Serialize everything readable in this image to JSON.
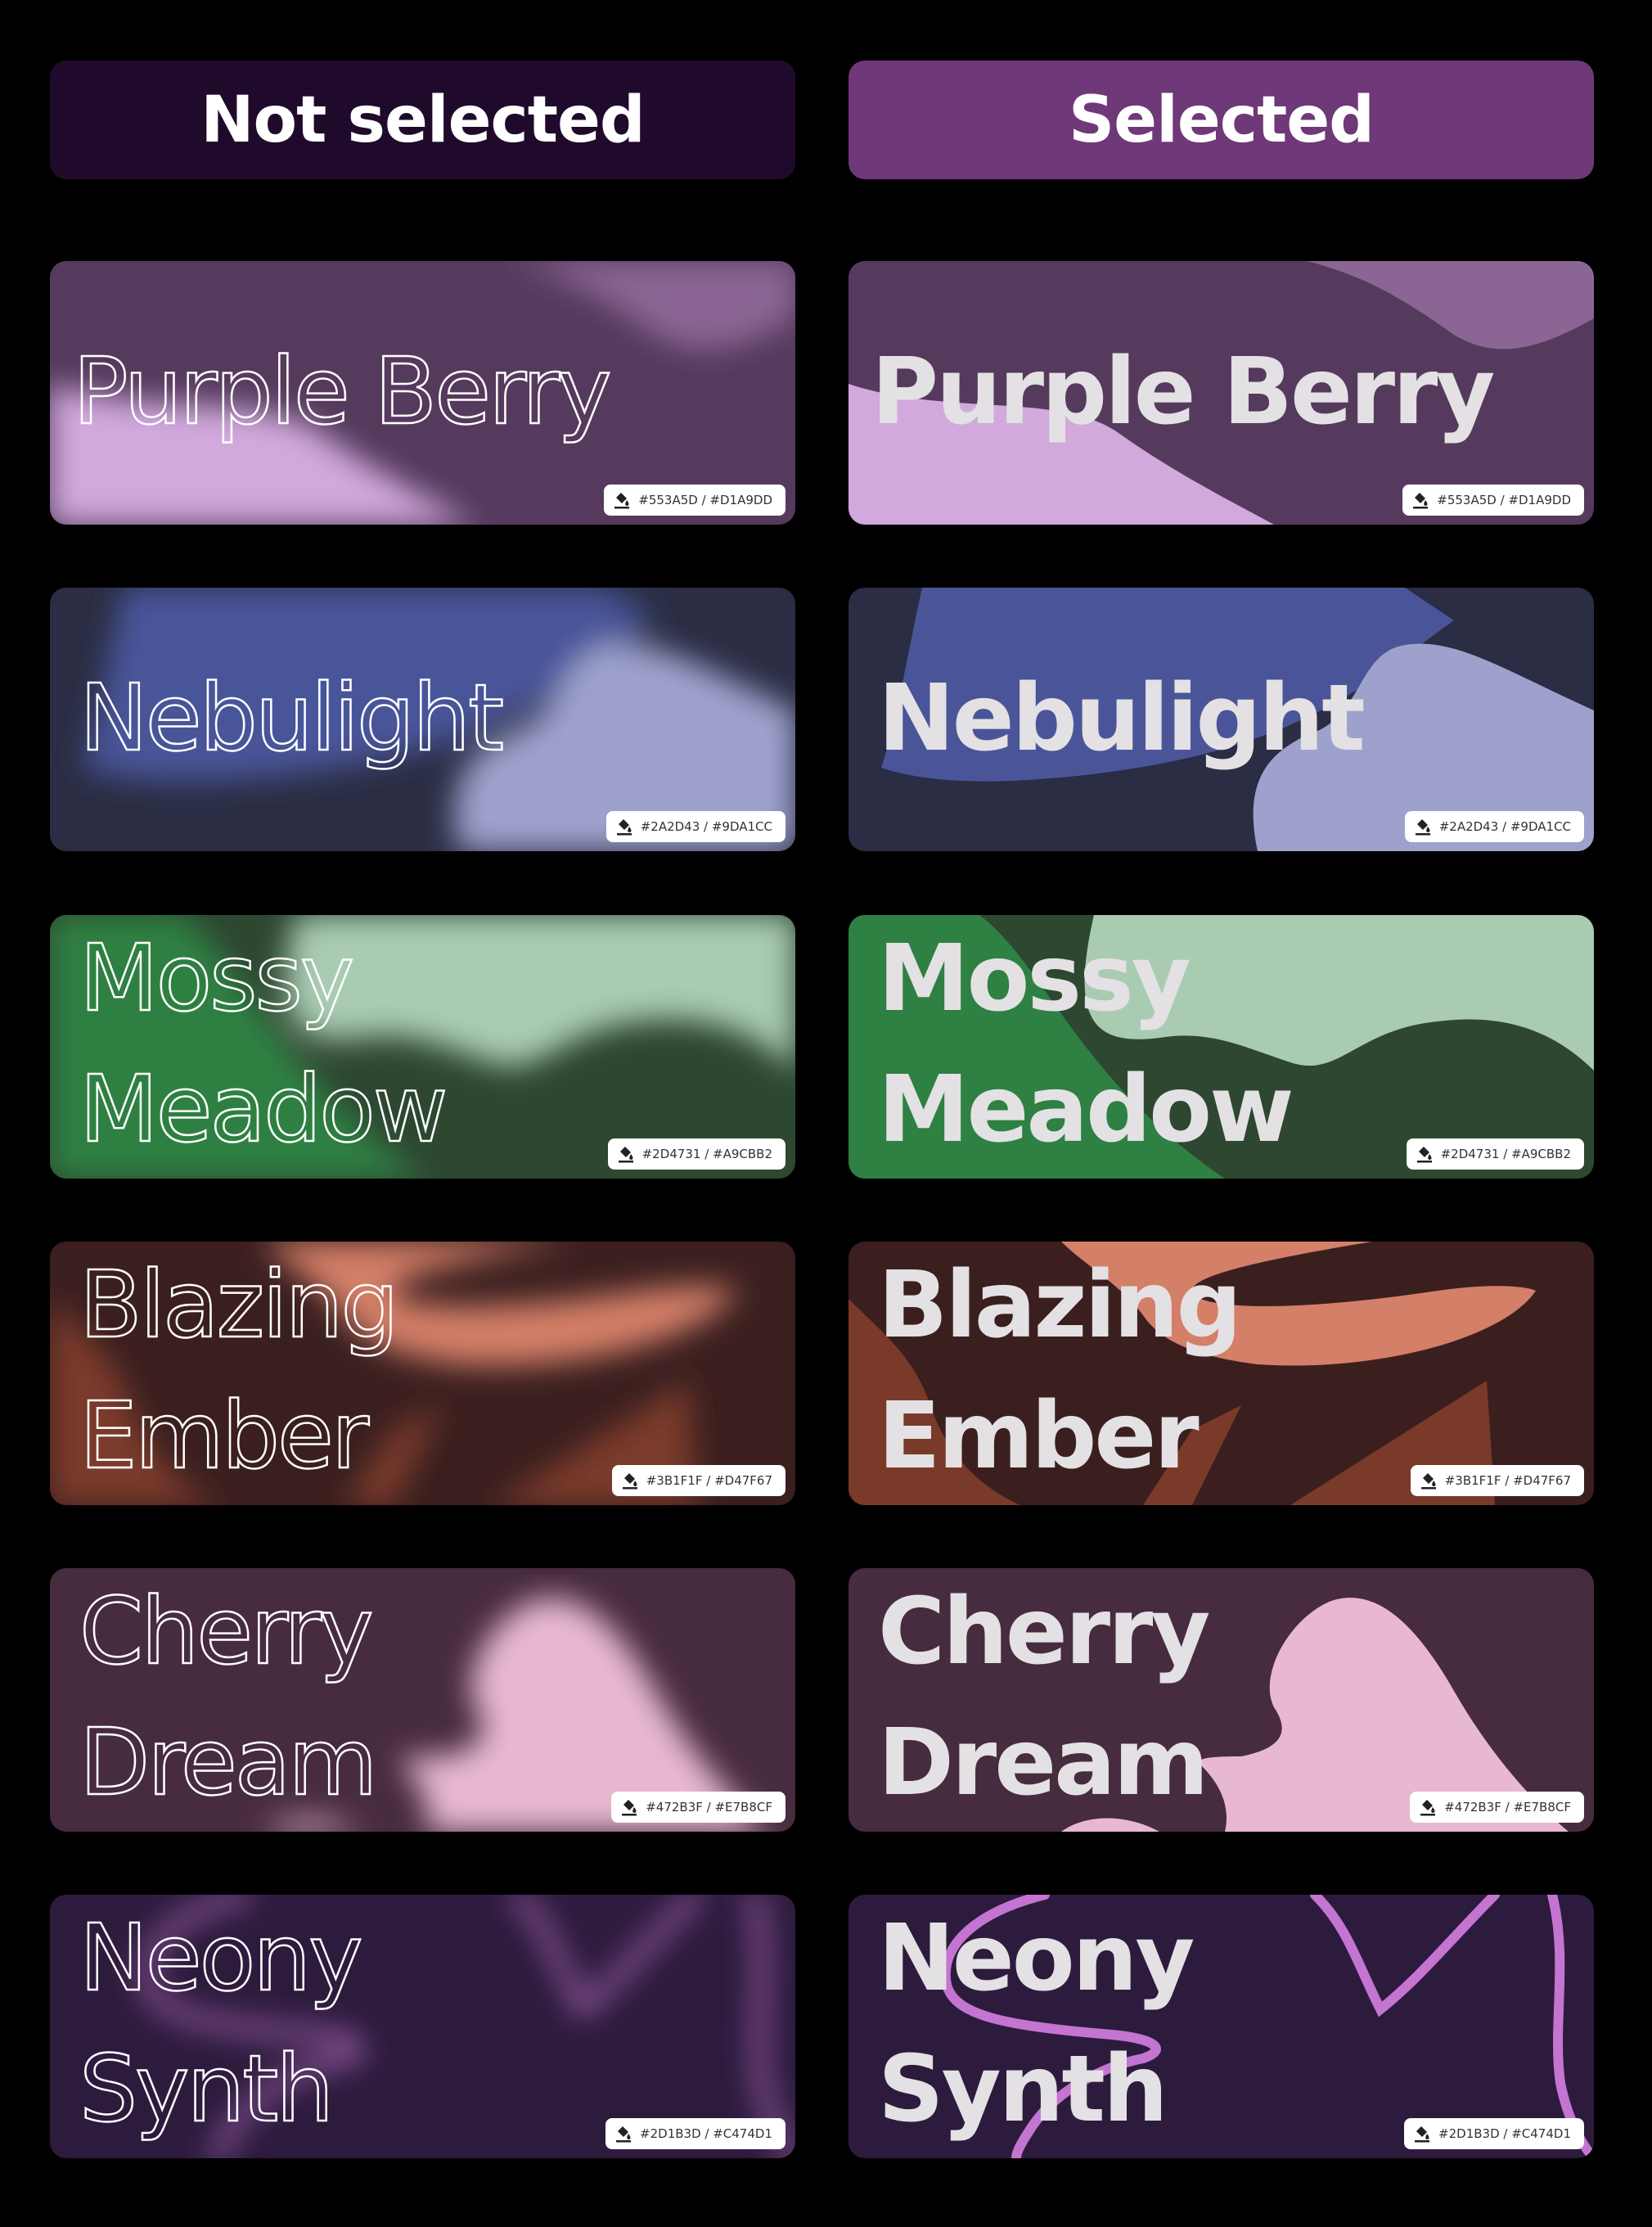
{
  "headers": {
    "not_selected": "Not selected",
    "selected": "Selected",
    "not_selected_color": "#200A2C",
    "selected_color": "#6F3878"
  },
  "themes": [
    {
      "name": "Purple Berry",
      "lines": [
        "Purple Berry"
      ],
      "codes": "#553A5D / #D1A9DD",
      "bg": "#553A5D",
      "accent": "#D1A9DD",
      "accent2": "#8B6694"
    },
    {
      "name": "Nebulight",
      "lines": [
        "Nebulight"
      ],
      "codes": "#2A2D43 / #9DA1CC",
      "bg": "#2A2D43",
      "accent": "#9DA1CC",
      "accent2": "#4A5599"
    },
    {
      "name": "Mossy Meadow",
      "lines": [
        "Mossy",
        "Meadow"
      ],
      "codes": "#2D4731 / #A9CBB2",
      "bg": "#2D4731",
      "accent": "#A9CBB2",
      "accent2": "#2E8043"
    },
    {
      "name": "Blazing Ember",
      "lines": [
        "Blazing",
        "Ember"
      ],
      "codes": "#3B1F1F / #D47F67",
      "bg": "#3B1F1F",
      "accent": "#D47F67",
      "accent2": "#7A3A2A"
    },
    {
      "name": "Cherry Dream",
      "lines": [
        "Cherry",
        "Dream"
      ],
      "codes": "#472B3F / #E7B8CF",
      "bg": "#472B3F",
      "accent": "#E7B8CF",
      "accent2": "#E7B8CF"
    },
    {
      "name": "Neony Synth",
      "lines": [
        "Neony",
        "Synth"
      ],
      "codes": "#2D1B3D / #C474D1",
      "bg": "#2D1B3D",
      "accent": "#C474D1",
      "accent2": "#C474D1"
    }
  ],
  "icons": {
    "badge": "paint-bucket-icon"
  }
}
